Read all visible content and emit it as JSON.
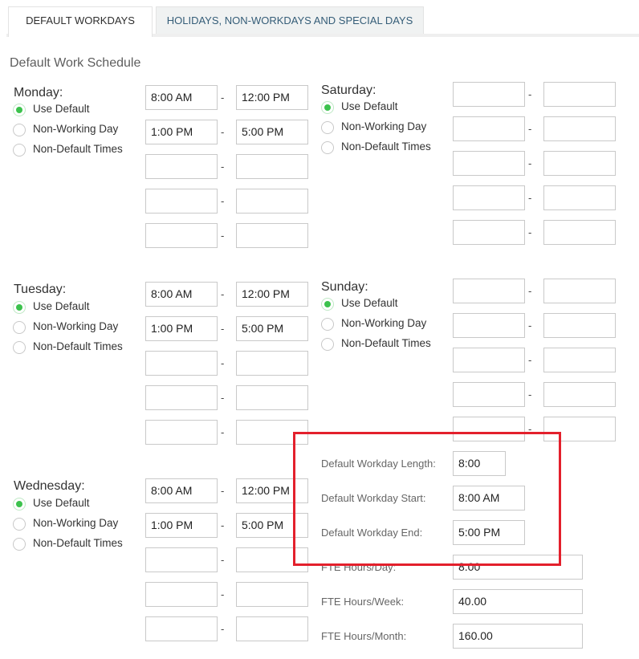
{
  "tabs": [
    {
      "label": "DEFAULT WORKDAYS"
    },
    {
      "label": "HOLIDAYS, NON-WORKDAYS AND SPECIAL DAYS"
    }
  ],
  "section_title": "Default Work Schedule",
  "radio_options": [
    "Use Default",
    "Non-Working Day",
    "Non-Default Times"
  ],
  "separator": "-",
  "days": [
    {
      "name": "Monday:",
      "selected": "Use Default",
      "times": [
        [
          "8:00 AM",
          "12:00 PM"
        ],
        [
          "1:00 PM",
          "5:00 PM"
        ],
        [
          "",
          ""
        ],
        [
          "",
          ""
        ],
        [
          "",
          ""
        ]
      ]
    },
    {
      "name": "Tuesday:",
      "selected": "Use Default",
      "times": [
        [
          "8:00 AM",
          "12:00 PM"
        ],
        [
          "1:00 PM",
          "5:00 PM"
        ],
        [
          "",
          ""
        ],
        [
          "",
          ""
        ],
        [
          "",
          ""
        ]
      ]
    },
    {
      "name": "Wednesday:",
      "selected": "Use Default",
      "times": [
        [
          "8:00 AM",
          "12:00 PM"
        ],
        [
          "1:00 PM",
          "5:00 PM"
        ],
        [
          "",
          ""
        ],
        [
          "",
          ""
        ],
        [
          "",
          ""
        ]
      ]
    },
    {
      "name": "Saturday:",
      "selected": "Use Default",
      "times": [
        [
          "",
          ""
        ],
        [
          "",
          ""
        ],
        [
          "",
          ""
        ],
        [
          "",
          ""
        ],
        [
          "",
          ""
        ]
      ]
    },
    {
      "name": "Sunday:",
      "selected": "Use Default",
      "times": [
        [
          "",
          ""
        ],
        [
          "",
          ""
        ],
        [
          "",
          ""
        ],
        [
          "",
          ""
        ],
        [
          "",
          ""
        ]
      ]
    }
  ],
  "settings": {
    "workday_length": {
      "label": "Default Workday Length:",
      "value": "8:00"
    },
    "workday_start": {
      "label": "Default Workday Start:",
      "value": "8:00 AM"
    },
    "workday_end": {
      "label": "Default Workday End:",
      "value": "5:00 PM"
    },
    "fte_day": {
      "label": "FTE Hours/Day:",
      "value": "8.00"
    },
    "fte_week": {
      "label": "FTE Hours/Week:",
      "value": "40.00"
    },
    "fte_month": {
      "label": "FTE Hours/Month:",
      "value": "160.00"
    }
  },
  "colors": {
    "radio_checked": "#3cc24d",
    "highlight_border": "#e3202c",
    "tab_inactive_text": "#355d78"
  }
}
